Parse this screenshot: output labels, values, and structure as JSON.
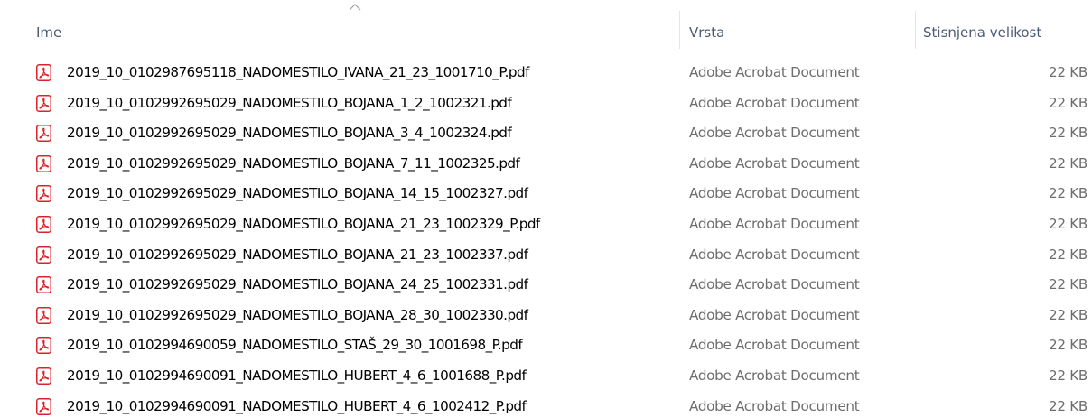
{
  "columns": {
    "name": "Ime",
    "type": "Vrsta",
    "size": "Stisnjena velikost",
    "sort": "ascending"
  },
  "icon_color": "#d9222a",
  "files": [
    {
      "name": "2019_10_0102987695118_NADOMESTILO_IVANA_21_23_1001710_P.pdf",
      "type": "Adobe Acrobat Document",
      "size": "22 KB",
      "icon": "pdf-file-icon"
    },
    {
      "name": "2019_10_0102992695029_NADOMESTILO_BOJANA_1_2_1002321.pdf",
      "type": "Adobe Acrobat Document",
      "size": "22 KB",
      "icon": "pdf-file-icon"
    },
    {
      "name": "2019_10_0102992695029_NADOMESTILO_BOJANA_3_4_1002324.pdf",
      "type": "Adobe Acrobat Document",
      "size": "22 KB",
      "icon": "pdf-file-icon"
    },
    {
      "name": "2019_10_0102992695029_NADOMESTILO_BOJANA_7_11_1002325.pdf",
      "type": "Adobe Acrobat Document",
      "size": "22 KB",
      "icon": "pdf-file-icon"
    },
    {
      "name": "2019_10_0102992695029_NADOMESTILO_BOJANA_14_15_1002327.pdf",
      "type": "Adobe Acrobat Document",
      "size": "22 KB",
      "icon": "pdf-file-icon"
    },
    {
      "name": "2019_10_0102992695029_NADOMESTILO_BOJANA_21_23_1002329_P.pdf",
      "type": "Adobe Acrobat Document",
      "size": "22 KB",
      "icon": "pdf-file-icon"
    },
    {
      "name": "2019_10_0102992695029_NADOMESTILO_BOJANA_21_23_1002337.pdf",
      "type": "Adobe Acrobat Document",
      "size": "22 KB",
      "icon": "pdf-file-icon"
    },
    {
      "name": "2019_10_0102992695029_NADOMESTILO_BOJANA_24_25_1002331.pdf",
      "type": "Adobe Acrobat Document",
      "size": "22 KB",
      "icon": "pdf-file-icon"
    },
    {
      "name": "2019_10_0102992695029_NADOMESTILO_BOJANA_28_30_1002330.pdf",
      "type": "Adobe Acrobat Document",
      "size": "22 KB",
      "icon": "pdf-file-icon"
    },
    {
      "name": "2019_10_0102994690059_NADOMESTILO_STAŠ_29_30_1001698_P.pdf",
      "type": "Adobe Acrobat Document",
      "size": "22 KB",
      "icon": "pdf-file-icon"
    },
    {
      "name": "2019_10_0102994690091_NADOMESTILO_HUBERT_4_6_1001688_P.pdf",
      "type": "Adobe Acrobat Document",
      "size": "22 KB",
      "icon": "pdf-file-icon"
    },
    {
      "name": "2019_10_0102994690091_NADOMESTILO_HUBERT_4_6_1002412_P.pdf",
      "type": "Adobe Acrobat Document",
      "size": "22 KB",
      "icon": "pdf-file-icon"
    }
  ]
}
